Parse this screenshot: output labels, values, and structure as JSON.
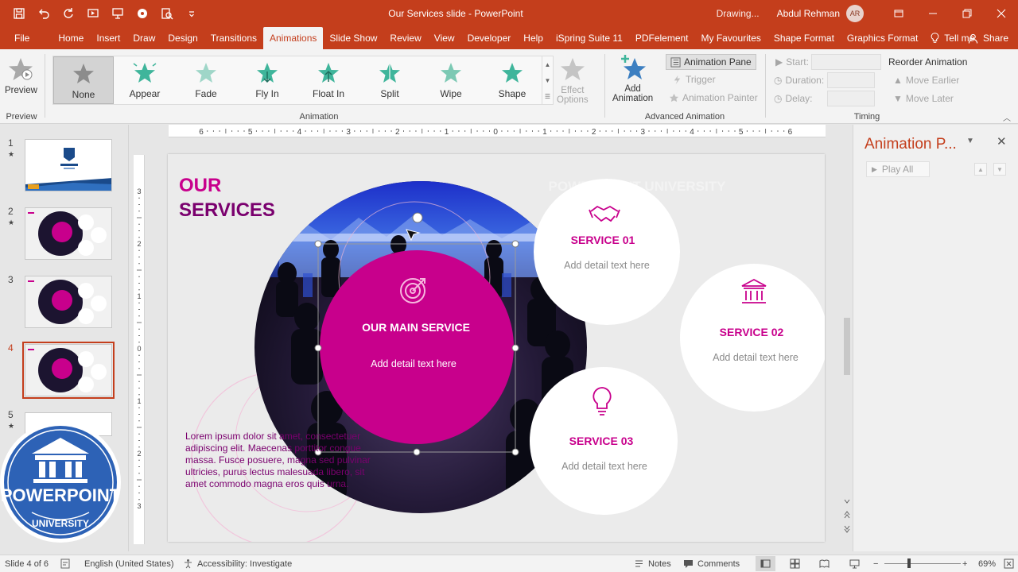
{
  "window": {
    "title": "Our Services slide  -  PowerPoint",
    "status_text": "Drawing...",
    "user_name": "Abdul Rehman",
    "user_initials": "AR"
  },
  "tabs": [
    "File",
    "Home",
    "Insert",
    "Draw",
    "Design",
    "Transitions",
    "Animations",
    "Slide Show",
    "Review",
    "View",
    "Developer",
    "Help",
    "iSpring Suite 11",
    "PDFelement",
    "My Favourites",
    "Shape Format",
    "Graphics Format"
  ],
  "active_tab": "Animations",
  "tell_me": "Tell me",
  "share": "Share",
  "ribbon": {
    "preview": {
      "label": "Preview",
      "group": "Preview"
    },
    "animation_group": "Animation",
    "animations": [
      {
        "label": "None",
        "color": "#8c8c8c"
      },
      {
        "label": "Appear",
        "color": "#3fb59b"
      },
      {
        "label": "Fade",
        "color": "#9fd6c8"
      },
      {
        "label": "Fly In",
        "color": "#3fb59b"
      },
      {
        "label": "Float In",
        "color": "#3fb59b"
      },
      {
        "label": "Split",
        "color": "#3fb59b"
      },
      {
        "label": "Wipe",
        "color": "#7cc9b4"
      },
      {
        "label": "Shape",
        "color": "#3fb59b"
      }
    ],
    "effect_options_1": "Effect",
    "effect_options_2": "Options",
    "add_animation_1": "Add",
    "add_animation_2": "Animation",
    "animation_pane": "Animation Pane",
    "trigger": "Trigger",
    "animation_painter": "Animation Painter",
    "advanced_group": "Advanced Animation",
    "start": "Start:",
    "duration": "Duration:",
    "delay": "Delay:",
    "reorder": "Reorder Animation",
    "move_earlier": "Move Earlier",
    "move_later": "Move Later",
    "timing_group": "Timing"
  },
  "thumbnails": [
    {
      "num": "1",
      "star": "★"
    },
    {
      "num": "2",
      "star": "★"
    },
    {
      "num": "3",
      "star": ""
    },
    {
      "num": "4",
      "star": ""
    },
    {
      "num": "5",
      "star": "★"
    }
  ],
  "logo": {
    "text": "POWERPOINT",
    "sub": "UNIVERSITY"
  },
  "slide": {
    "title_line1": "OUR",
    "title_line2": "SERVICES",
    "watermark": "POWERPOINT UNIVERSITY",
    "main_service_title": "OUR MAIN SERVICE",
    "main_service_text": "Add detail text here",
    "services": [
      {
        "title": "SERVICE 01",
        "text": "Add detail text here"
      },
      {
        "title": "SERVICE 02",
        "text": "Add detail text here"
      },
      {
        "title": "SERVICE 03",
        "text": "Add detail text here"
      }
    ],
    "lorem_lines": [
      "Lorem ipsum dolor sit amet, consectetuer",
      "adipiscing elit. Maecenas porttitor congue",
      "massa. Fusce posuere, magna sed pulvinar",
      "ultricies, purus lectus malesuada libero, sit",
      "amet commodo magna eros quis urna."
    ],
    "colors": {
      "magenta": "#c8008c",
      "purple": "#7a006e",
      "text_grey": "#7f7f7f"
    }
  },
  "animation_pane": {
    "title": "Animation P...",
    "play_all": "Play All"
  },
  "status": {
    "slide": "Slide 4 of 6",
    "language": "English (United States)",
    "accessibility": "Accessibility: Investigate",
    "notes": "Notes",
    "comments": "Comments",
    "zoom": "69%"
  },
  "ruler": {
    "h": [
      "6",
      "5",
      "4",
      "3",
      "2",
      "1",
      "0",
      "1",
      "2",
      "3",
      "4",
      "5",
      "6"
    ],
    "v": [
      "3",
      "2",
      "1",
      "0",
      "1",
      "2",
      "3"
    ]
  }
}
